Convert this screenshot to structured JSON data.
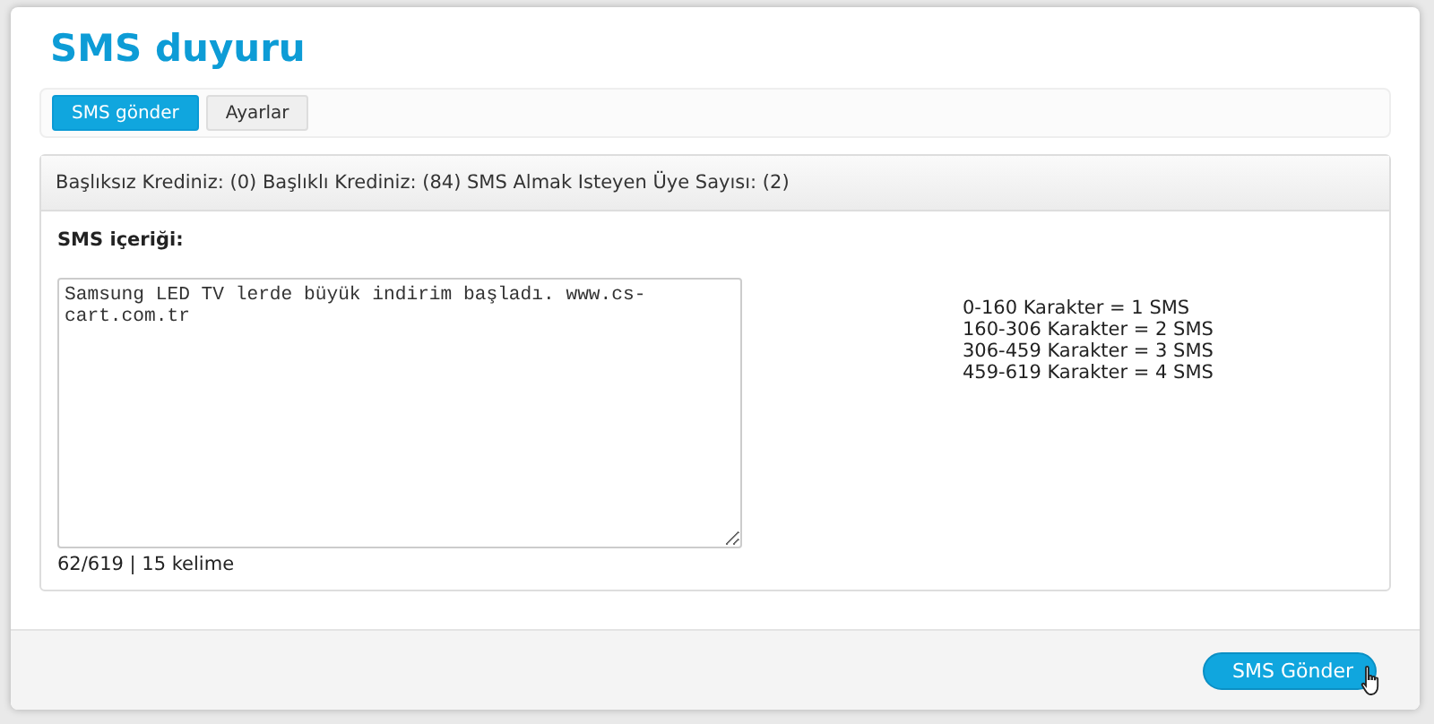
{
  "page": {
    "title": "SMS duyuru"
  },
  "tabs": [
    {
      "label": "SMS gönder",
      "selected": true
    },
    {
      "label": "Ayarlar",
      "selected": false
    }
  ],
  "panel": {
    "header": "Başlıksız Krediniz: (0) Başlıklı Krediniz: (84) SMS Almak Isteyen Üye Sayısı: (2)",
    "content_label": "SMS içeriği:",
    "message": {
      "value": "Samsung LED TV lerde büyük indirim başladı. www.cs-cart.com.tr"
    },
    "counter": "62/619 | 15 kelime",
    "rates": [
      "0-160 Karakter = 1 SMS",
      "160-306 Karakter = 2 SMS",
      "306-459 Karakter = 3 SMS",
      "459-619 Karakter = 4 SMS"
    ]
  },
  "footer": {
    "button": "SMS Gönder"
  }
}
